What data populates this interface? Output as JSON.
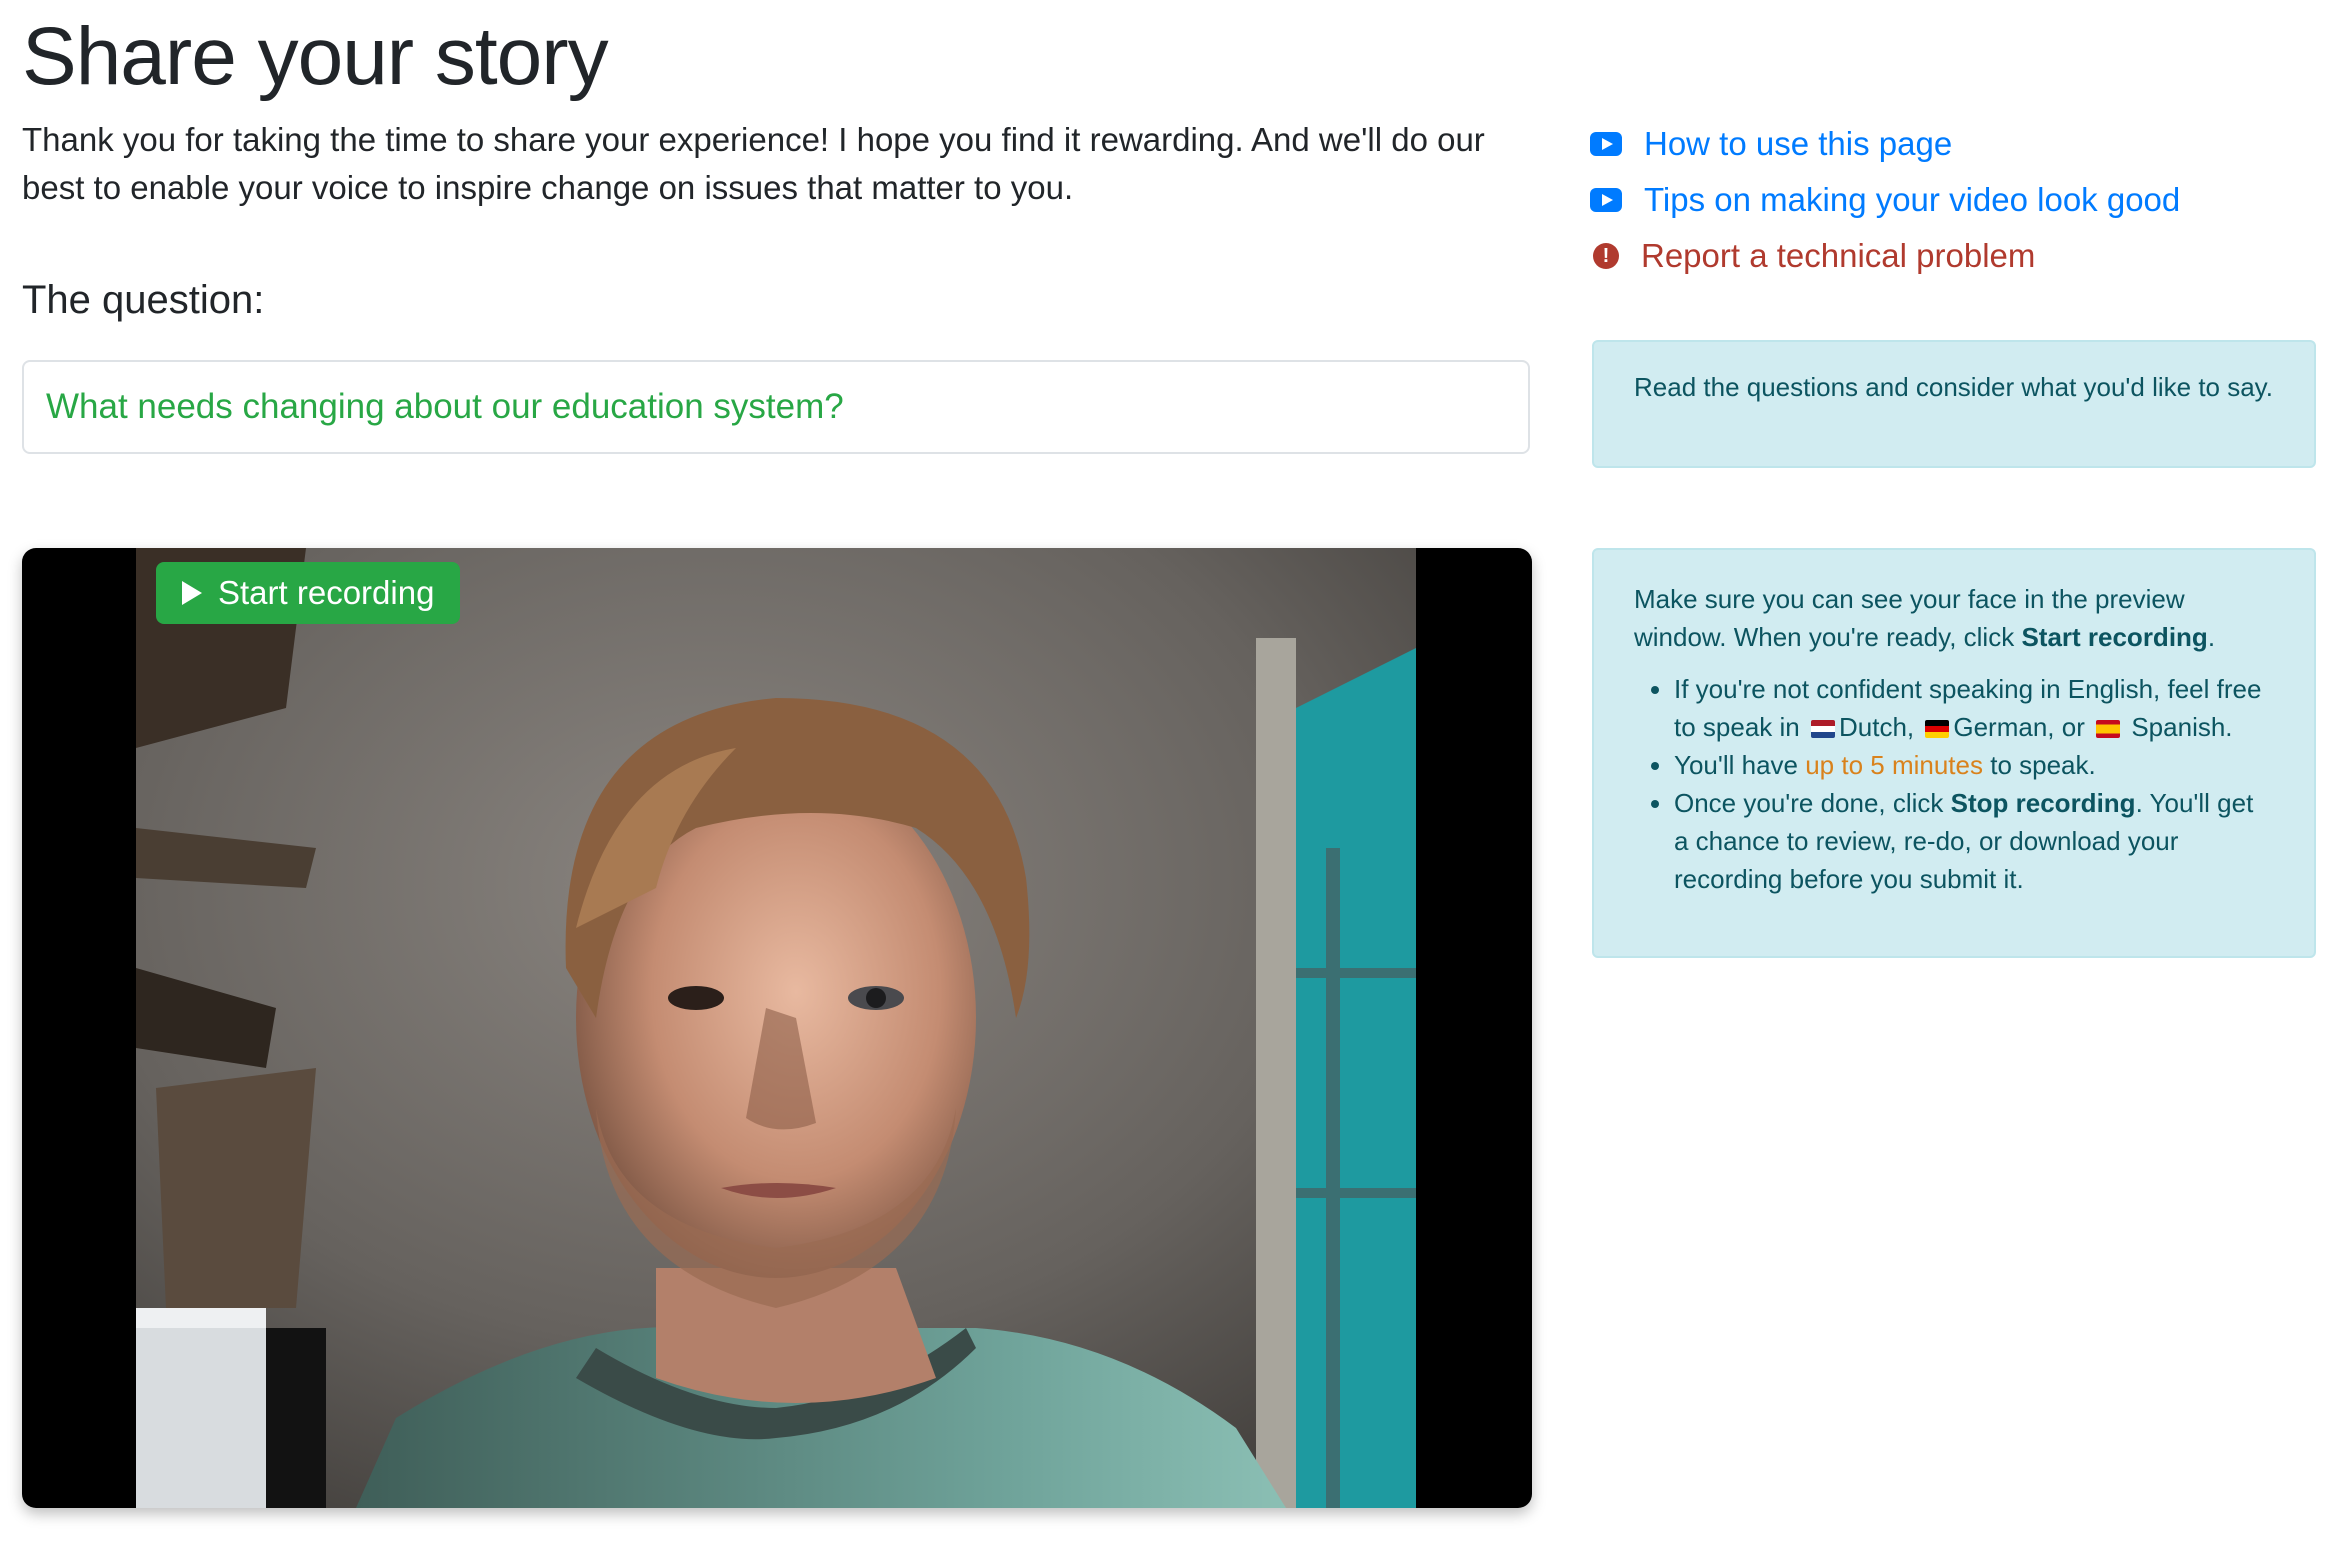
{
  "page": {
    "title": "Share your story",
    "intro": "Thank you for taking the time to share your experience! I hope you find it rewarding. And we'll do our best to enable your voice to inspire change on issues that matter to you."
  },
  "question": {
    "heading": "The question:",
    "text": "What needs changing about our education system?"
  },
  "video": {
    "start_label": "Start recording"
  },
  "links": [
    {
      "label": "How to use this page",
      "icon": "youtube-play-icon"
    },
    {
      "label": "Tips on making your video look good",
      "icon": "youtube-play-icon"
    },
    {
      "label": "Report a technical problem",
      "icon": "exclamation-circle-icon"
    }
  ],
  "info1": {
    "text": "Read the questions and consider what you'd like to say."
  },
  "info2": {
    "intro_pre": "Make sure you can see your face in the preview window. When you're ready, click ",
    "intro_bold": "Start recording",
    "intro_post": ".",
    "bullet1_pre": "If you're not confident speaking in English, feel free to speak in",
    "lang1": "Dutch,",
    "lang2": "German, or",
    "lang3": "Spanish.",
    "bullet2_pre": "You'll have ",
    "bullet2_highlight": "up to 5 minutes",
    "bullet2_post": " to speak.",
    "bullet3_pre": "Once you're done, click ",
    "bullet3_bold": "Stop recording",
    "bullet3_post": ". You'll get a chance to review, re-do, or download your recording before you submit it."
  },
  "colors": {
    "primary": "#007bff",
    "success": "#28a745",
    "danger": "#b03a2e",
    "info_bg": "#d1ecf1",
    "info_text": "#0c5460",
    "highlight": "#d9821c"
  }
}
